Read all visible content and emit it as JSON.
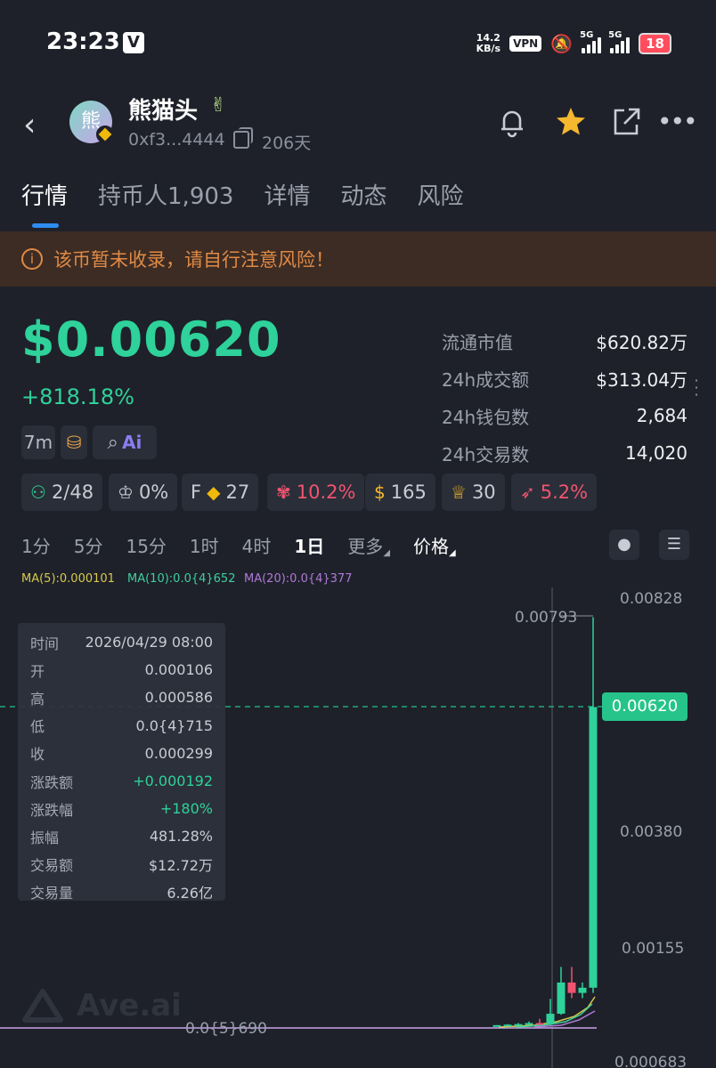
{
  "status_bar": {
    "time": "23:23",
    "badge": "V",
    "net_speed": "14.2",
    "net_unit": "KB/s",
    "vpn": "VPN",
    "sig1": "5G",
    "sig2": "5G",
    "battery": "18"
  },
  "header": {
    "avatar_char": "熊",
    "token_name": "熊猫头",
    "address": "0xf3...4444",
    "age": "206天"
  },
  "tabs": [
    {
      "label": "行情"
    },
    {
      "label": "持币人1,903"
    },
    {
      "label": "详情"
    },
    {
      "label": "动态"
    },
    {
      "label": "风险"
    }
  ],
  "warning": {
    "text": "该币暂未收录，请自行注意风险！"
  },
  "price": {
    "value": "$0.00620",
    "change": "+818.18%"
  },
  "stats": [
    {
      "key": "流通市值",
      "value": "$620.82万"
    },
    {
      "key": "24h成交额",
      "value": "$313.04万"
    },
    {
      "key": "24h钱包数",
      "value": "2,684"
    },
    {
      "key": "24h交易数",
      "value": "14,020"
    }
  ],
  "chips": {
    "age": "7m"
  },
  "badges": {
    "holders": "2/48",
    "chef": "0%",
    "f_label": "F",
    "f_count": "27",
    "insider": "10.2%",
    "bag": "165",
    "trophy": "30",
    "rocket": "5.2%"
  },
  "timeframes": {
    "items": [
      "1分",
      "5分",
      "15分",
      "1时",
      "4时",
      "1日"
    ],
    "active": "1日",
    "more": "更多",
    "price": "价格"
  },
  "ma": {
    "ma5": "MA(5):0.000101",
    "ma10": "MA(10):0.0{4}652",
    "ma20": "MA(20):0.0{4}377"
  },
  "colors": {
    "up": "#2ed29a",
    "down": "#ef5470",
    "ma5": "#d8c94a",
    "ma10": "#3fcf9e",
    "ma20": "#b07ad6"
  },
  "tooltip": [
    {
      "key": "时间",
      "value": "2026/04/29 08:00"
    },
    {
      "key": "开",
      "value": "0.000106"
    },
    {
      "key": "高",
      "value": "0.000586"
    },
    {
      "key": "低",
      "value": "0.0{4}715"
    },
    {
      "key": "收",
      "value": "0.000299"
    },
    {
      "key": "涨跌额",
      "value": "+0.000192"
    },
    {
      "key": "涨跌幅",
      "value": "+180%"
    },
    {
      "key": "振幅",
      "value": "481.28%"
    },
    {
      "key": "交易额",
      "value": "$12.72万"
    },
    {
      "key": "交易量",
      "value": "6.26亿"
    }
  ],
  "chart_data": {
    "type": "candlestick",
    "y_axis_labels": [
      "0.00828",
      "0.00380",
      "0.00155",
      "0.000683"
    ],
    "current_price": "0.00620",
    "high_label": "0.00793",
    "low_label": "0.0{5}690",
    "candles": [
      {
        "open": 7e-05,
        "high": 8e-05,
        "low": 7e-05,
        "close": 8e-05
      },
      {
        "open": 8e-05,
        "high": 0.0001,
        "low": 7e-05,
        "close": 9e-05
      },
      {
        "open": 9e-05,
        "high": 0.00012,
        "low": 8e-05,
        "close": 0.0001
      },
      {
        "open": 0.0001,
        "high": 0.00015,
        "low": 9e-05,
        "close": 0.00012
      },
      {
        "open": 0.00012,
        "high": 0.0002,
        "low": 0.0001,
        "close": 0.00011
      },
      {
        "open": 0.000106,
        "high": 0.000586,
        "low": 7.15e-05,
        "close": 0.000299
      },
      {
        "open": 0.0003,
        "high": 0.0012,
        "low": 0.00028,
        "close": 0.0009
      },
      {
        "open": 0.0009,
        "high": 0.0012,
        "low": 0.0006,
        "close": 0.0007
      },
      {
        "open": 0.0007,
        "high": 0.0009,
        "low": 0.0006,
        "close": 0.0008
      },
      {
        "open": 0.0008,
        "high": 0.00793,
        "low": 0.0007,
        "close": 0.0062
      }
    ]
  },
  "watermark": "Ave.ai"
}
